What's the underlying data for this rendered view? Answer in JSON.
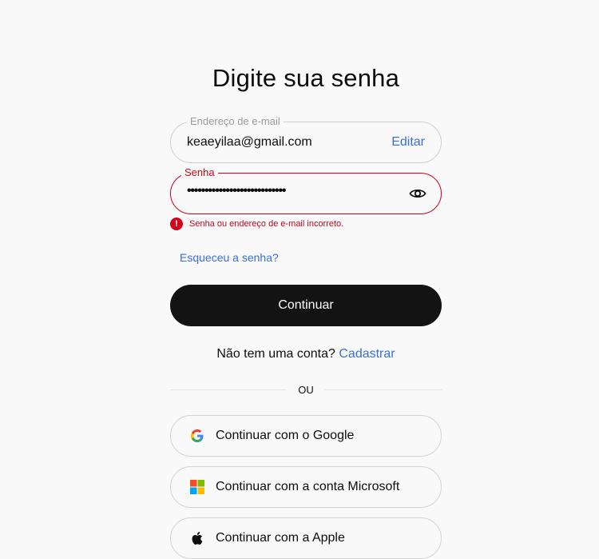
{
  "title": "Digite sua senha",
  "email": {
    "legend": "Endereço de e-mail",
    "value": "keaeyilaa@gmail.com",
    "edit_label": "Editar"
  },
  "password": {
    "legend": "Senha",
    "value": "••••••••••••••••••••••••••••",
    "toggle_icon": "eye-icon"
  },
  "error": {
    "icon_text": "!",
    "message": "Senha ou endereço de e-mail incorreto."
  },
  "forgot_label": "Esqueceu a senha?",
  "continue_label": "Continuar",
  "signup": {
    "prompt": "Não tem uma conta?",
    "link": "Cadastrar"
  },
  "divider_label": "OU",
  "social": {
    "google_label": "Continuar com o Google",
    "microsoft_label": "Continuar com a conta Microsoft",
    "apple_label": "Continuar com a Apple"
  },
  "colors": {
    "accent": "#3a6fd8",
    "error": "#d0021b",
    "button": "#131313",
    "background": "#f9f9f9"
  }
}
